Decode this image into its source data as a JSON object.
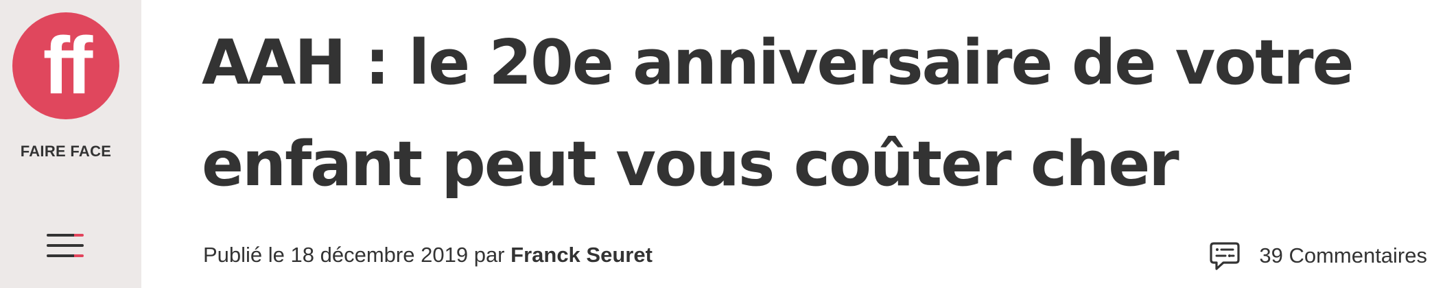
{
  "brand": {
    "name": "FAIRE FACE",
    "logo_text": "ff",
    "logo_color": "#e0475d"
  },
  "menu": {
    "icon": "hamburger-menu-icon",
    "accent_color": "#e2445c"
  },
  "article": {
    "title": "AAH : le 20e anniversaire de votre enfant peut vous coûter cher",
    "published_prefix": "Publié le",
    "date": "18 décembre 2019",
    "by": "par",
    "author": "Franck Seuret",
    "comments": {
      "icon": "comment-bubble-icon",
      "count_label": "39 Commentaires"
    }
  }
}
